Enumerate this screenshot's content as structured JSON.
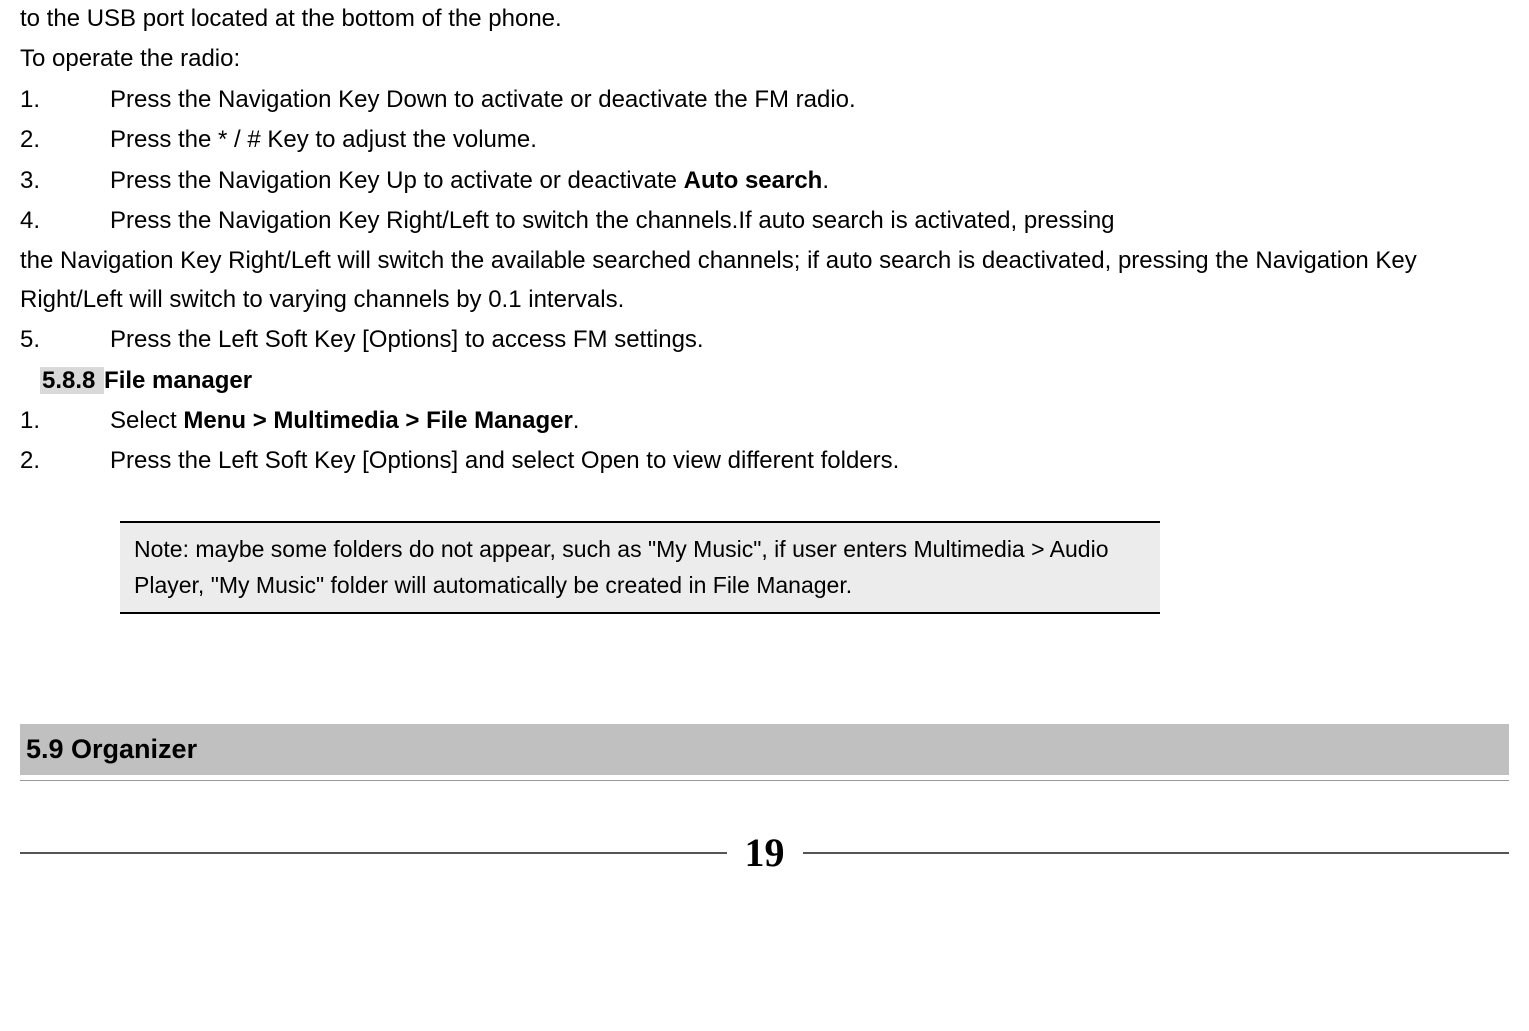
{
  "intro": {
    "line1": "to the USB port located at the bottom of the phone.",
    "line2": "To operate the radio:"
  },
  "radio_list": {
    "n1": "1.",
    "t1": "Press the Navigation Key Down to activate or deactivate the FM radio.",
    "n2": "2.",
    "t2": "Press the * / # Key to adjust the volume.",
    "n3": "3.",
    "t3a": "Press the Navigation Key Up to activate or deactivate ",
    "t3b": "Auto search",
    "t3c": ".",
    "n4": "4.",
    "t4": "Press the Navigation Key Right/Left to switch the channels.If auto search is activated, pressing",
    "t4_cont": "the Navigation Key Right/Left will switch the available searched channels; if auto search is deactivated, pressing the Navigation Key Right/Left will switch to varying channels by 0.1 intervals.",
    "n5": "5.",
    "t5": "Press the Left Soft Key [Options] to access FM settings."
  },
  "subsection": {
    "num": "5.8.8 ",
    "title": "File manager"
  },
  "file_list": {
    "n1": "1.",
    "t1a": "Select ",
    "t1b": "Menu > Multimedia > File Manager",
    "t1c": ".",
    "n2": "2.",
    "t2": "Press the Left Soft Key [Options] and select Open to view different folders."
  },
  "note": "Note: maybe some folders do not appear, such as \"My Music\", if user enters Multimedia > Audio Player, \"My Music\" folder will automatically be created in File Manager.",
  "section": {
    "title": "5.9 Organizer"
  },
  "page_number": "19"
}
